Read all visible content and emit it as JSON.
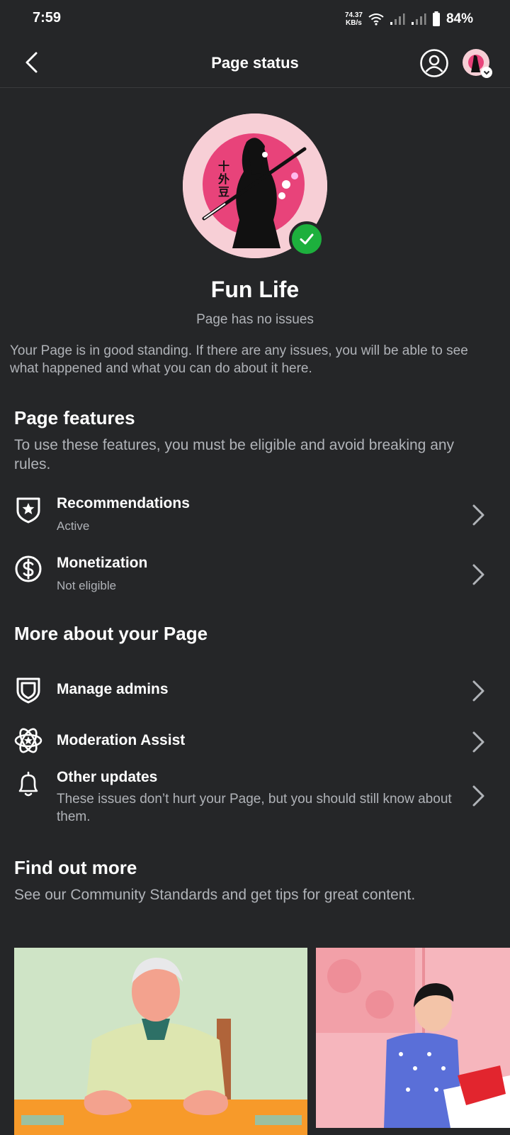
{
  "status_bar": {
    "time": "7:59",
    "net_speed_value": "74.37",
    "net_speed_unit": "KB/s",
    "battery": "84%",
    "icons": [
      "wifi-icon",
      "signal-icon",
      "signal-icon",
      "battery-icon"
    ]
  },
  "header": {
    "title": "Page status"
  },
  "page": {
    "name": "Fun Life",
    "status": "Page has no issues",
    "standing_message": "Your Page is in good standing. If there are any issues, you will be able to see what happened and what you can do about it here."
  },
  "features": {
    "title": "Page features",
    "description": "To use these features, you must be eligible and avoid breaking any rules.",
    "items": [
      {
        "label": "Recommendations",
        "sub": "Active",
        "icon": "shield-star-icon"
      },
      {
        "label": "Monetization",
        "sub": "Not eligible",
        "icon": "dollar-circle-icon"
      }
    ]
  },
  "more": {
    "title": "More about your Page",
    "items": [
      {
        "label": "Manage admins",
        "icon": "shield-icon"
      },
      {
        "label": "Moderation Assist",
        "icon": "atom-star-icon"
      },
      {
        "label": "Other updates",
        "sub": "These issues don’t hurt your Page, but you should still know about them.",
        "icon": "bell-icon"
      }
    ]
  },
  "find_out": {
    "title": "Find out more",
    "description": "See our Community Standards and get tips for great content."
  },
  "colors": {
    "background": "#252628",
    "verified": "#1db03d",
    "avatar_bg": "#f7cfd6",
    "avatar_accent": "#e8437a"
  }
}
